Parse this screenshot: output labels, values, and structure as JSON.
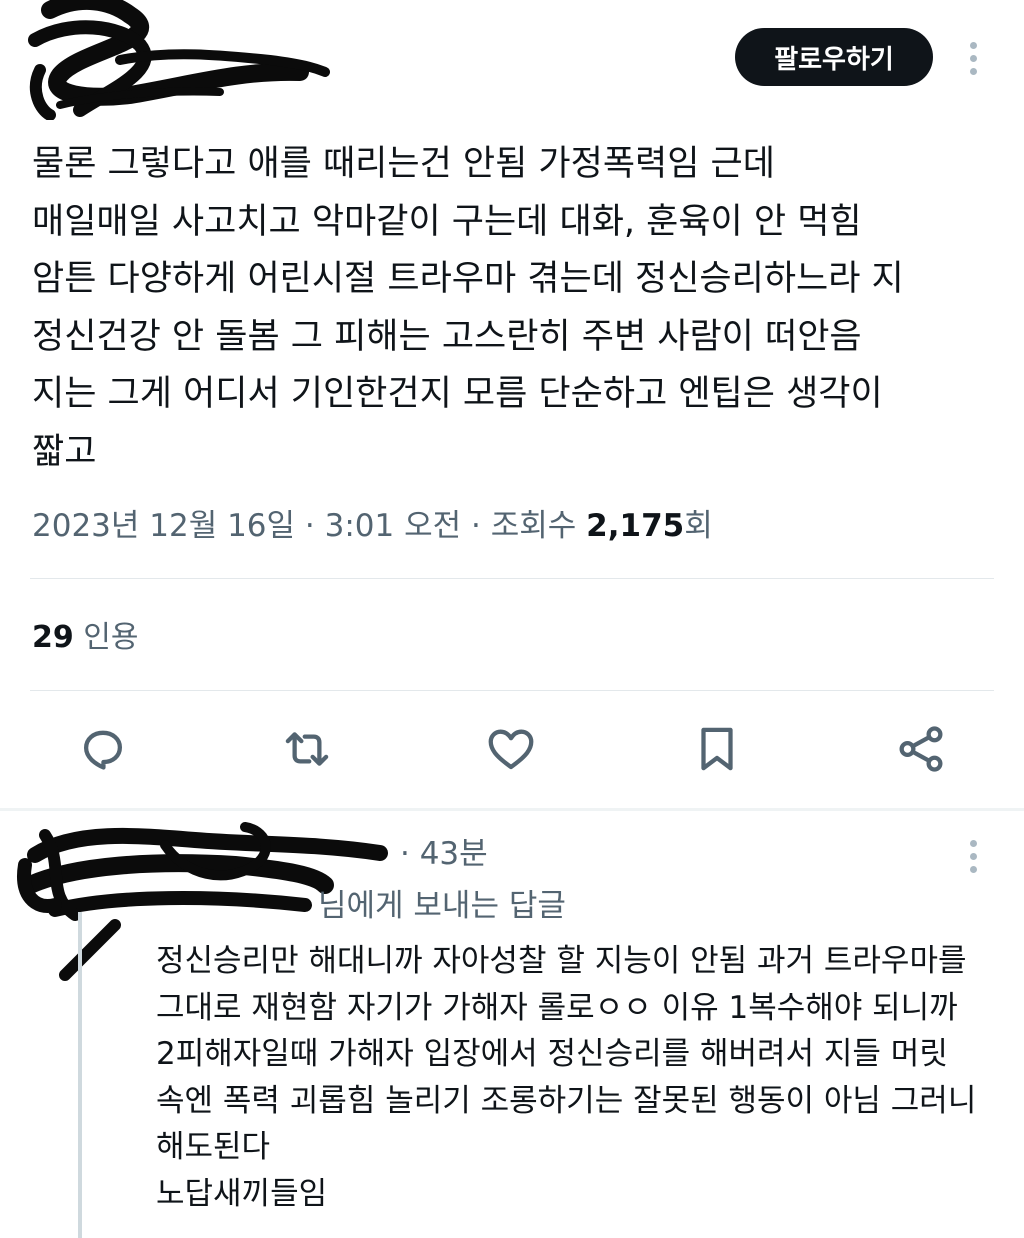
{
  "tweet": {
    "follow_label": "팔로우하기",
    "text_lines": [
      "물론 그렇다고 애를 때리는건 안됨 가정폭력임 근데",
      "매일매일 사고치고 악마같이 구는데 대화, 훈육이 안 먹힘",
      "암튼 다양하게 어린시절 트라우마 겪는데 정신승리하느라 지",
      "정신건강 안 돌봄 그 피해는 고스란히 주변 사람이 떠안음",
      "지는 그게 어디서 기인한건지 모름 단순하고 엔팁은 생각이",
      "짧고"
    ],
    "meta": {
      "date": "2023년 12월 16일",
      "separator": "·",
      "time": "3:01 오전",
      "views_label": "조회수",
      "views_count": "2,175",
      "views_suffix": "회"
    },
    "quotes": {
      "count": "29",
      "label": "인용"
    },
    "actions": [
      "reply-icon",
      "retweet-icon",
      "like-icon",
      "bookmark-icon",
      "share-icon"
    ]
  },
  "reply": {
    "time": "· 43분",
    "replying_to_suffix": "님에게 보내는 답글",
    "text_lines": [
      "정신승리만 해대니까 자아성찰 할 지능이 안됨 과거 트라우마를",
      "그대로 재현함 자기가 가해자 롤로ㅇㅇ 이유 1복수해야 되니까",
      "2피해자일때 가해자 입장에서 정신승리를 해버려서 지들 머릿",
      "속엔 폭력 괴롭힘 놀리기 조롱하기는 잘못된 행동이 아님 그러니",
      "해도된다",
      "노답새끼들임"
    ]
  },
  "colors": {
    "text": "#0f1419",
    "secondary": "#536471",
    "button_bg": "#0f1419",
    "divider": "#e3e8eb"
  }
}
